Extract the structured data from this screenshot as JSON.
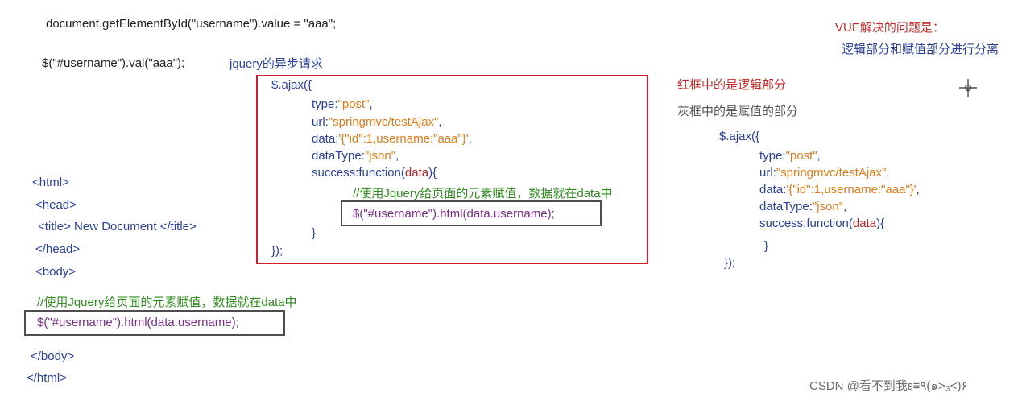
{
  "top": {
    "line1": "document.getElementById(\"username\").value = \"aaa\";",
    "line2": "$(\"#username\").val(\"aaa\");",
    "jquery_label": "jquery的异步请求"
  },
  "vue_note": {
    "title": "VUE解决的问题是：",
    "desc": "逻辑部分和赋值部分进行分离"
  },
  "legend": {
    "red": "红框中的是逻辑部分",
    "grey": "灰框中的是赋值的部分"
  },
  "ajax_center": {
    "l1": "$.ajax({",
    "type_key": "type:",
    "type_val": "\"post\"",
    "type_end": ",",
    "url_key": "url:",
    "url_val": "\"springmvc/testAjax\"",
    "url_end": ",",
    "data_key": "data:",
    "data_val": "'{\"id\":1,username:\"aaa\"}'",
    "data_end": ",",
    "dt_key": "dataType:",
    "dt_val": "\"json\"",
    "dt_end": ",",
    "succ_a": "success:function(",
    "succ_b": "data",
    "succ_c": "){",
    "comment": "//使用Jquery给页面的元素赋值，数据就在data中",
    "assign": "$(\"#username\").html(data.username);",
    "close1": "}",
    "close2": "});"
  },
  "ajax_right": {
    "l1": "$.ajax({",
    "type_key": "type:",
    "type_val": "\"post\"",
    "type_end": ",",
    "url_key": "url:",
    "url_val": "\"springmvc/testAjax\"",
    "url_end": ",",
    "data_key": "data:",
    "data_val": "'{\"id\":1,username:\"aaa\"}'",
    "data_end": ",",
    "dt_key": "dataType:",
    "dt_val": "\"json\"",
    "dt_end": ",",
    "succ_a": "success:function(",
    "succ_b": "data",
    "succ_c": "){",
    "close1": "}",
    "close2": "});"
  },
  "html_left": {
    "l1": "<html>",
    "l2": "<head>",
    "l3": "<title> New Document </title>",
    "l4": "</head>",
    "l5": "<body>",
    "comment": "//使用Jquery给页面的元素赋值，数据就在data中",
    "assign": "$(\"#username\").html(data.username);",
    "l6": "</body>",
    "l7": "</html>"
  },
  "watermark": "CSDN @看不到我ε≡٩(๑>₃<)۶",
  "colors": {
    "red_box": "#cc1f2d",
    "grey_box": "#4d4d4d",
    "code_blue": "#2a3f9c",
    "string_orange": "#e07b1a",
    "comment_green": "#2e8b1e"
  }
}
